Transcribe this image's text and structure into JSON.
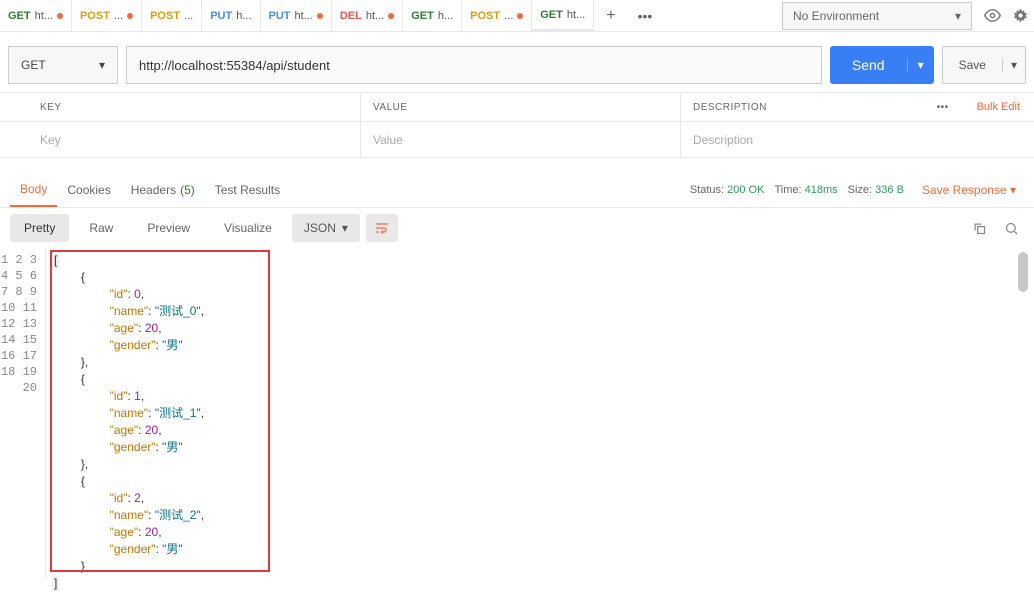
{
  "env": {
    "label": "No Environment"
  },
  "tabs": [
    {
      "method": "GET",
      "cls": "m-get",
      "title": "ht...",
      "dirty": true
    },
    {
      "method": "POST",
      "cls": "m-post",
      "title": "...",
      "dirty": true
    },
    {
      "method": "POST",
      "cls": "m-post",
      "title": "...",
      "dirty": false
    },
    {
      "method": "PUT",
      "cls": "m-put",
      "title": "h...",
      "dirty": false
    },
    {
      "method": "PUT",
      "cls": "m-put",
      "title": "ht...",
      "dirty": true
    },
    {
      "method": "DEL",
      "cls": "m-del",
      "title": "ht...",
      "dirty": true
    },
    {
      "method": "GET",
      "cls": "m-get",
      "title": "h...",
      "dirty": false
    },
    {
      "method": "POST",
      "cls": "m-post",
      "title": "...",
      "dirty": true
    },
    {
      "method": "GET",
      "cls": "m-get",
      "title": "ht...",
      "dirty": false,
      "active": true
    }
  ],
  "request": {
    "method": "GET",
    "url": "http://localhost:55384/api/student"
  },
  "actions": {
    "send": "Send",
    "save": "Save"
  },
  "params": {
    "headers": {
      "key": "KEY",
      "value": "VALUE",
      "desc": "DESCRIPTION",
      "bulk": "Bulk Edit"
    },
    "placeholders": {
      "key": "Key",
      "value": "Value",
      "desc": "Description"
    }
  },
  "respTabs": {
    "body": "Body",
    "cookies": "Cookies",
    "headers": "Headers",
    "headersCount": "(5)",
    "test": "Test Results"
  },
  "status": {
    "statusLabel": "Status:",
    "statusVal": "200 OK",
    "timeLabel": "Time:",
    "timeVal": "418ms",
    "sizeLabel": "Size:",
    "sizeVal": "336 B",
    "saveResp": "Save Response"
  },
  "view": {
    "pretty": "Pretty",
    "raw": "Raw",
    "preview": "Preview",
    "visualize": "Visualize",
    "format": "JSON"
  },
  "responseBody": [
    {
      "id": 0,
      "name": "测试_0",
      "age": 20,
      "gender": "男"
    },
    {
      "id": 1,
      "name": "测试_1",
      "age": 20,
      "gender": "男"
    },
    {
      "id": 2,
      "name": "测试_2",
      "age": 20,
      "gender": "男"
    }
  ]
}
